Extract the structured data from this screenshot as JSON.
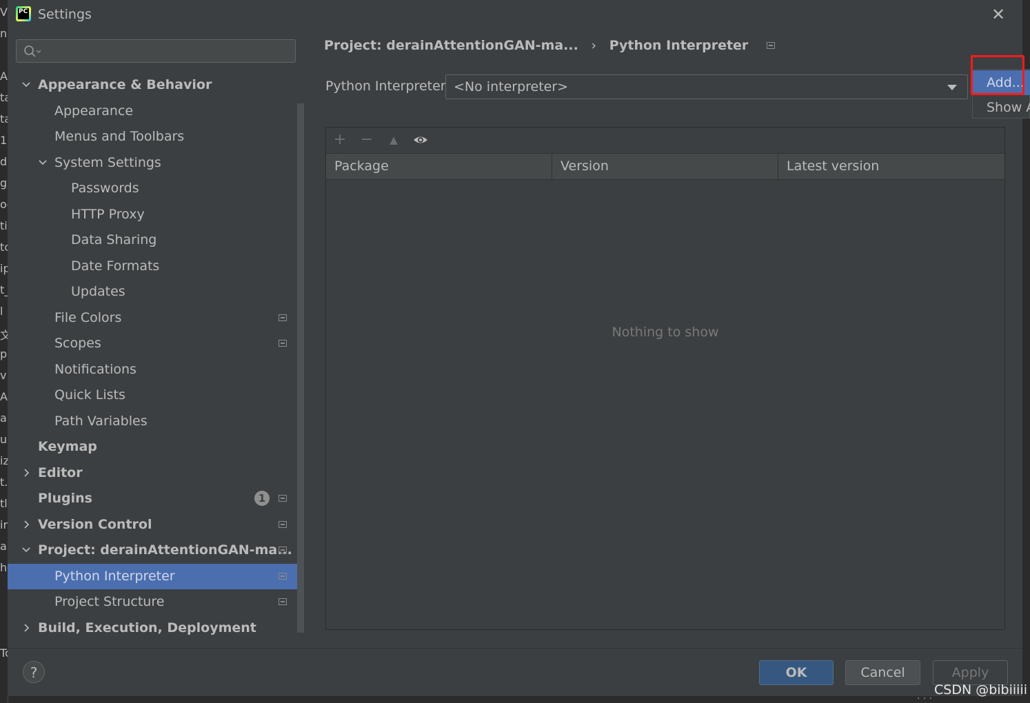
{
  "window": {
    "title": "Settings"
  },
  "search": {
    "placeholder": ""
  },
  "sidebar": {
    "items": [
      {
        "label": "Appearance & Behavior",
        "level": 0,
        "bold": true,
        "expanded": true
      },
      {
        "label": "Appearance",
        "level": 1
      },
      {
        "label": "Menus and Toolbars",
        "level": 1
      },
      {
        "label": "System Settings",
        "level": 1,
        "expanded": true
      },
      {
        "label": "Passwords",
        "level": 2
      },
      {
        "label": "HTTP Proxy",
        "level": 2
      },
      {
        "label": "Data Sharing",
        "level": 2
      },
      {
        "label": "Date Formats",
        "level": 2
      },
      {
        "label": "Updates",
        "level": 2
      },
      {
        "label": "File Colors",
        "level": 1
      },
      {
        "label": "Scopes",
        "level": 1
      },
      {
        "label": "Notifications",
        "level": 1
      },
      {
        "label": "Quick Lists",
        "level": 1
      },
      {
        "label": "Path Variables",
        "level": 1
      },
      {
        "label": "Keymap",
        "level": 0,
        "bold": true
      },
      {
        "label": "Editor",
        "level": 0,
        "bold": true,
        "expanded": false
      },
      {
        "label": "Plugins",
        "level": 0,
        "bold": true,
        "badge": "1"
      },
      {
        "label": "Version Control",
        "level": 0,
        "bold": true,
        "expanded": false
      },
      {
        "label": "Project: derainAttentionGAN-ma...",
        "level": 0,
        "bold": true,
        "expanded": true
      },
      {
        "label": "Python Interpreter",
        "level": 1,
        "selected": true
      },
      {
        "label": "Project Structure",
        "level": 1
      },
      {
        "label": "Build, Execution, Deployment",
        "level": 0,
        "bold": true,
        "expanded": false
      }
    ]
  },
  "breadcrumb": {
    "project": "Project: derainAttentionGAN-ma...",
    "separator": "›",
    "page": "Python Interpreter"
  },
  "interpreter": {
    "label": "Python Interpreter:",
    "value": "<No interpreter>"
  },
  "popup": {
    "items": [
      "Add...",
      "Show All..."
    ]
  },
  "packages_table": {
    "columns": [
      "Package",
      "Version",
      "Latest version"
    ],
    "empty_text": "Nothing to show"
  },
  "toolbar": {
    "add": "+",
    "remove": "−",
    "upgrade": "▲"
  },
  "footer": {
    "help": "?",
    "ok": "OK",
    "cancel": "Cancel",
    "apply": "Apply"
  },
  "watermark": "CSDN @bibiiiii",
  "left_edge_letters": [
    "V",
    "n",
    "",
    "A",
    "ta",
    "ta",
    "1",
    "d",
    "gs",
    "oc",
    "ti",
    "tc",
    "ip",
    "t_",
    "l",
    "文",
    "p",
    "vi",
    "A",
    "a",
    "u",
    "iz",
    "t.",
    "tl",
    "ir",
    "a",
    "h",
    "",
    "",
    "",
    "Tc"
  ],
  "colors": {
    "selection": "#4b6eaf",
    "highlight": "#ff1a1a",
    "ok_button": "#365880",
    "background": "#3c3f41"
  }
}
